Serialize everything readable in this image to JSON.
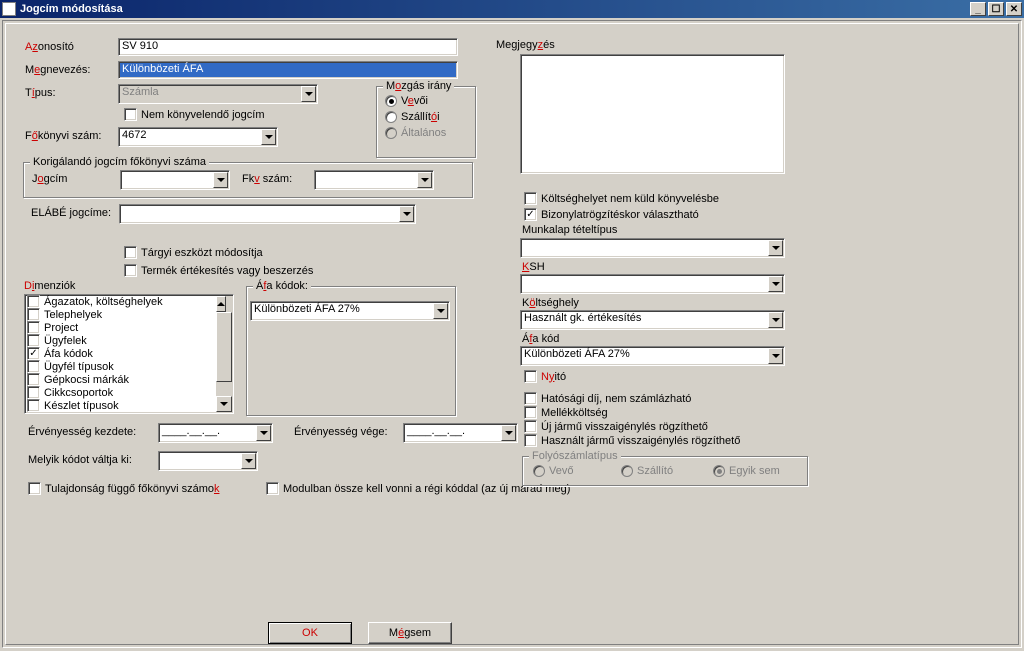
{
  "window": {
    "title": "Jogcím módosítása"
  },
  "labels": {
    "azonosito_pre": "A",
    "azonosito_hot": "z",
    "azonosito_post": "onosító",
    "megnevezes_pre": "M",
    "megnevezes_hot": "e",
    "megnevezes_post": "gnevezés:",
    "tipus_pre": "T",
    "tipus_hot": "í",
    "tipus_post": "pus:",
    "fokonyvi_pre": "F",
    "fokonyvi_hot": "ő",
    "fokonyvi_post": "könyvi szám:",
    "korig_legend": "Korigálandó jogcím főkönyvi száma",
    "jogcim_pre": "J",
    "jogcim_hot": "o",
    "jogcim_post": "gcím",
    "fkvszam_pre": "Fk",
    "fkvszam_hot": "v",
    "fkvszam_post": " szám:",
    "elabe": "ELÁBÉ jogcíme:",
    "targyi": "Tárgyi eszközt módosítja",
    "termek": "Termék értékesítés vagy beszerzés",
    "dimenziok_pre": "D",
    "dimenziok_hot": "i",
    "dimenziok_post": "menziók",
    "afakodok_pre": "Á",
    "afakodok_hot": "f",
    "afakodok_post": "a kódok:",
    "erv_kezdet": "Érvényesség kezdete:",
    "erv_vege": "Érvényesség vége:",
    "melyik": "Melyik kódot váltja ki:",
    "tulajdonsag_pre": "Tulajdonság függő főkönyvi számo",
    "tulajdonsag_hot": "k",
    "modulban": "Modulban össze kell vonni a régi kóddal (az új marad meg)",
    "megjegyzes_pre": "Megjegy",
    "megjegyzes_hot": "z",
    "megjegyzes_post": "és",
    "koltseghely_nokonyv": "Költséghelyet nem küld könyvelésbe",
    "bizonylat": "Bizonylatrögzítéskor választható",
    "munkalap": "Munkalap tételtípus",
    "ksh_pre": "K",
    "ksh_hot": "S",
    "ksh_post": "H",
    "koltseghely_pre": "K",
    "koltseghely_hot": "ö",
    "koltseghely_post": "ltséghely",
    "afakod_pre": "Á",
    "afakod_hot": "f",
    "afakod_post": "a kód",
    "nyito_pre": "N",
    "nyito_hot": "y",
    "nyito_post": "itó",
    "hatosagi": "Hatósági díj, nem számlázható",
    "mellek": "Mellékköltség",
    "ujjarm": "Új jármű visszaigénylés rögzíthető",
    "hasznjarm": "Használt jármű visszaigénylés rögzíthető",
    "folyo_legend": "Folyószámlatípus",
    "folyo_vevo": "Vevő",
    "folyo_szallito": "Szállító",
    "folyo_egyik": "Egyik sem",
    "mozgas_legend": "M",
    "mozgas_hot": "o",
    "mozgas_post": "zgás irány",
    "vevoi_pre": "V",
    "vevoi_hot": "e",
    "vevoi_post": "vői",
    "szallitoi_pre": "Szállít",
    "szallitoi_hot": "ó",
    "szallitoi_post": "i",
    "altalanos": "Általános",
    "nemkonyv": "Nem könyvelendő jogcím",
    "ok": "OK",
    "megsem_pre": "M",
    "megsem_hot": "é",
    "megsem_post": "gsem"
  },
  "fields": {
    "azonosito": "SV 910",
    "megnevezes": "Különbözeti ÁFA",
    "tipus": "Számla",
    "fokonyvi": "4672",
    "jogcim": "",
    "fkvszam": "",
    "elabe": "",
    "afakodok_combo": "Különbözeti ÁFA 27%",
    "munkalap": "",
    "ksh": "",
    "koltseghely": "Használt gk. értékesítés",
    "afakod": "Különbözeti ÁFA 27%",
    "erv_kezdet": "____.__.__.",
    "erv_vege": "____.__.__.",
    "melyik": ""
  },
  "dimenziok": [
    {
      "label": "Ágazatok, költséghelyek",
      "checked": false
    },
    {
      "label": "Telephelyek",
      "checked": false
    },
    {
      "label": "Project",
      "checked": false
    },
    {
      "label": "Ügyfelek",
      "checked": false
    },
    {
      "label": "Áfa kódok",
      "checked": true
    },
    {
      "label": "Ügyfél típusok",
      "checked": false
    },
    {
      "label": "Gépkocsi márkák",
      "checked": false
    },
    {
      "label": "Cikkcsoportok",
      "checked": false
    },
    {
      "label": "Készlet típusok",
      "checked": false
    }
  ]
}
